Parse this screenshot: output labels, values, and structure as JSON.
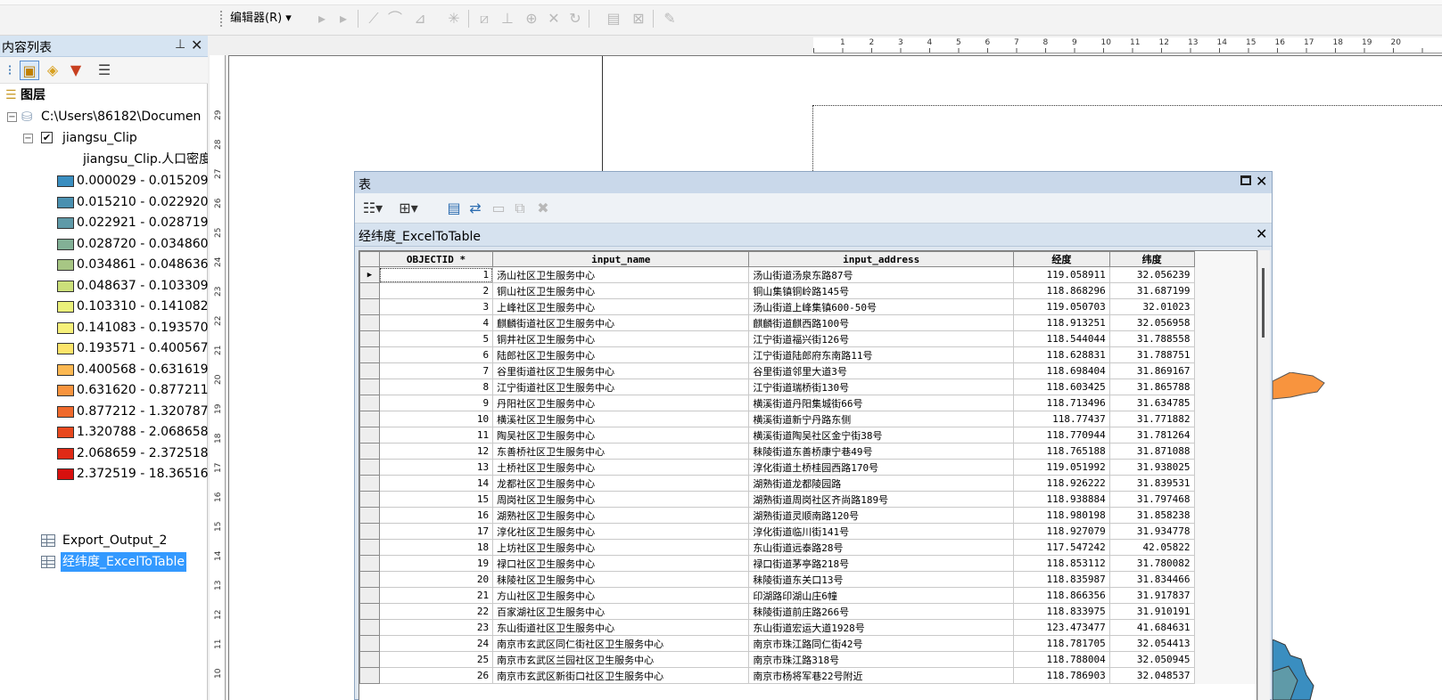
{
  "toolbar": {
    "editor_menu": "编辑器(R) ▾",
    "icons": [
      "edit-pointer-icon",
      "edit-vertices-icon",
      "straight-segment-icon",
      "end-point-arc-icon",
      "trace-icon",
      "point-icon",
      "split-icon",
      "topology-icon",
      "cut-icon",
      "reshape-icon",
      "rotate-icon",
      "attributes-icon",
      "sketch-properties-icon",
      "create-features-icon"
    ]
  },
  "toc": {
    "title": "内容列表",
    "root_label": "图层",
    "database_path": "C:\\Users\\86182\\Documen",
    "layer_name": "jiangsu_Clip",
    "layer_checked": "✔",
    "field_label": "jiangsu_Clip.人口密度",
    "legend": [
      {
        "label": "0.000029 - 0.015209",
        "color": "#3a8ec0"
      },
      {
        "label": "0.015210 - 0.022920",
        "color": "#4a90b0"
      },
      {
        "label": "0.022921 - 0.028719",
        "color": "#5f9aa8"
      },
      {
        "label": "0.028720 - 0.034860",
        "color": "#82b096"
      },
      {
        "label": "0.034861 - 0.048636",
        "color": "#a7c684"
      },
      {
        "label": "0.048637 - 0.103309",
        "color": "#cbe07a"
      },
      {
        "label": "0.103310 - 0.141082",
        "color": "#eaf07a"
      },
      {
        "label": "0.141083 - 0.193570",
        "color": "#f6f07a"
      },
      {
        "label": "0.193571 - 0.400567",
        "color": "#fce46a"
      },
      {
        "label": "0.400568 - 0.631619",
        "color": "#fbb852"
      },
      {
        "label": "0.631620 - 0.877211",
        "color": "#f8943e"
      },
      {
        "label": "0.877212 - 1.320787",
        "color": "#f06a2c"
      },
      {
        "label": "1.320788 - 2.068658",
        "color": "#e8481e"
      },
      {
        "label": "2.068659 - 2.372518",
        "color": "#e02a16"
      },
      {
        "label": "2.372519 - 18.365160",
        "color": "#d8100e"
      }
    ],
    "tables": [
      "Export_Output_2",
      "经纬度_ExcelToTable"
    ]
  },
  "ruler": {
    "vertical": [
      "29",
      "28",
      "27",
      "26",
      "25",
      "24",
      "23",
      "22",
      "21",
      "20",
      "19",
      "18",
      "17",
      "16",
      "15",
      "14",
      "13",
      "12",
      "11",
      "10"
    ],
    "horizontal": [
      "1",
      "2",
      "3",
      "4",
      "5",
      "6",
      "7",
      "8",
      "9",
      "10",
      "11",
      "12",
      "13",
      "14",
      "15",
      "16",
      "17",
      "18",
      "19",
      "20"
    ]
  },
  "table_window": {
    "title": "表",
    "tab_name": "经纬度_ExcelToTable",
    "columns": [
      "OBJECTID *",
      "input_name",
      "input_address",
      "经度",
      "纬度"
    ],
    "rows": [
      [
        "1",
        "汤山社区卫生服务中心",
        "汤山街道汤泉东路87号",
        "119.058911",
        "32.056239"
      ],
      [
        "2",
        "铜山社区卫生服务中心",
        "铜山集镇铜岭路145号",
        "118.868296",
        "31.687199"
      ],
      [
        "3",
        "上峰社区卫生服务中心",
        "汤山街道上峰集镇600-50号",
        "119.050703",
        "32.01023"
      ],
      [
        "4",
        "麒麟街道社区卫生服务中心",
        "麒麟街道麒西路100号",
        "118.913251",
        "32.056958"
      ],
      [
        "5",
        "铜井社区卫生服务中心",
        "江宁街道福兴街126号",
        "118.544044",
        "31.788558"
      ],
      [
        "6",
        "陆郎社区卫生服务中心",
        "江宁街道陆郎府东南路11号",
        "118.628831",
        "31.788751"
      ],
      [
        "7",
        "谷里街道社区卫生服务中心",
        "谷里街道邻里大道3号",
        "118.698404",
        "31.869167"
      ],
      [
        "8",
        "江宁街道社区卫生服务中心",
        "江宁街道瑞桥街130号",
        "118.603425",
        "31.865788"
      ],
      [
        "9",
        "丹阳社区卫生服务中心",
        "横溪街道丹阳集城街66号",
        "118.713496",
        "31.634785"
      ],
      [
        "10",
        "横溪社区卫生服务中心",
        "横溪街道新宁丹路东侧",
        "118.77437",
        "31.771882"
      ],
      [
        "11",
        "陶吴社区卫生服务中心",
        "横溪街道陶吴社区金宁街38号",
        "118.770944",
        "31.781264"
      ],
      [
        "12",
        "东善桥社区卫生服务中心",
        "秣陵街道东善桥康宁巷49号",
        "118.765188",
        "31.871088"
      ],
      [
        "13",
        "土桥社区卫生服务中心",
        "淳化街道土桥桂园西路170号",
        "119.051992",
        "31.938025"
      ],
      [
        "14",
        "龙都社区卫生服务中心",
        "湖熟街道龙都陵园路",
        "118.926222",
        "31.839531"
      ],
      [
        "15",
        "周岗社区卫生服务中心",
        "湖熟街道周岗社区齐尚路189号",
        "118.938884",
        "31.797468"
      ],
      [
        "16",
        "湖熟社区卫生服务中心",
        "湖熟街道灵顺南路120号",
        "118.980198",
        "31.858238"
      ],
      [
        "17",
        "淳化社区卫生服务中心",
        "淳化街道临川街141号",
        "118.927079",
        "31.934778"
      ],
      [
        "18",
        "上坊社区卫生服务中心",
        "东山街道远泰路28号",
        "117.547242",
        "42.05822"
      ],
      [
        "19",
        "禄口社区卫生服务中心",
        "禄口街道茅亭路218号",
        "118.853112",
        "31.780082"
      ],
      [
        "20",
        "秣陵社区卫生服务中心",
        "秣陵街道东关口13号",
        "118.835987",
        "31.834466"
      ],
      [
        "21",
        "方山社区卫生服务中心",
        "印湖路印湖山庄6幢",
        "118.866356",
        "31.917837"
      ],
      [
        "22",
        "百家湖社区卫生服务中心",
        "秣陵街道前庄路266号",
        "118.833975",
        "31.910191"
      ],
      [
        "23",
        "东山街道社区卫生服务中心",
        "东山街道宏运大道1928号",
        "123.473477",
        "41.684631"
      ],
      [
        "24",
        "南京市玄武区同仁街社区卫生服务中心",
        "南京市珠江路同仁街42号",
        "118.781705",
        "32.054413"
      ],
      [
        "25",
        "南京市玄武区兰园社区卫生服务中心",
        "南京市珠江路318号",
        "118.788004",
        "32.050945"
      ],
      [
        "26",
        "南京市玄武区新街口社区卫生服务中心",
        "南京市杨将军巷22号附近",
        "118.786903",
        "32.048537"
      ]
    ],
    "current_row_marker": "▶"
  }
}
